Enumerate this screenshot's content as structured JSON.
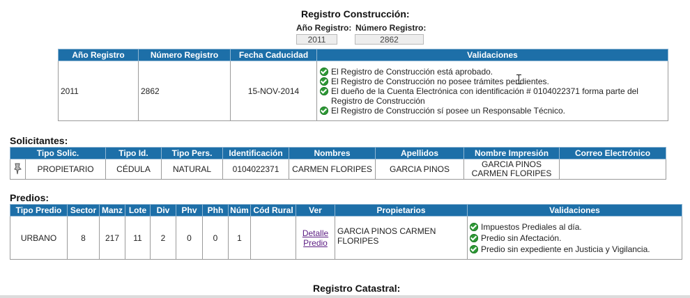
{
  "header": {
    "title": "Registro Construcción:",
    "anio_label": "Año Registro:",
    "numero_label": "Número Registro:",
    "anio_value": "2011",
    "numero_value": "2862"
  },
  "registro_table": {
    "columns": [
      "Año Registro",
      "Número Registro",
      "Fecha Caducidad",
      "Validaciones"
    ],
    "row": {
      "anio": "2011",
      "numero": "2862",
      "fecha": "15-NOV-2014",
      "validaciones": [
        "El Registro de Construcción está aprobado.",
        "El Registro de Construcción no posee trámites pendientes.",
        "El dueño de la Cuenta Electrónica con identificación # 0104022371 forma parte del Registro de Construcción",
        "El Registro de Construcción sí posee un Responsable Técnico."
      ]
    }
  },
  "solicitantes": {
    "section_title": "Solicitantes:",
    "columns": [
      "Tipo Solic.",
      "Tipo Id.",
      "Tipo Pers.",
      "Identificación",
      "Nombres",
      "Apellidos",
      "Nombre Impresión",
      "Correo Electrónico"
    ],
    "row": {
      "icon": "pin-icon",
      "tipo_solic": "PROPIETARIO",
      "tipo_id": "CÉDULA",
      "tipo_pers": "NATURAL",
      "identificacion": "0104022371",
      "nombres": "CARMEN FLORIPES",
      "apellidos": "GARCIA PINOS",
      "nombre_impresion_1": "GARCIA PINOS",
      "nombre_impresion_2": "CARMEN FLORIPES",
      "correo": ""
    }
  },
  "predios": {
    "section_title": "Predios:",
    "columns": [
      "Tipo Predio",
      "Sector",
      "Manz",
      "Lote",
      "Div",
      "Phv",
      "Phh",
      "Núm",
      "Cód Rural",
      "Ver",
      "Propietarios",
      "Validaciones"
    ],
    "row": {
      "tipo_predio": "URBANO",
      "sector": "8",
      "manz": "217",
      "lote": "11",
      "div": "2",
      "phv": "0",
      "phh": "0",
      "num": "1",
      "cod_rural": "",
      "ver_line1": "Detalle",
      "ver_line2": "Predio",
      "propietarios": "GARCIA PINOS CARMEN FLORIPES",
      "validaciones": [
        "Impuestos Prediales al día.",
        "Predio sin Afectación.",
        "Predio sin expediente en Justicia y Vigilancia."
      ]
    }
  },
  "catastral": {
    "title": "Registro Catastral:"
  },
  "colors": {
    "header_blue": "#1d6fa8",
    "check_green": "#2e9a36",
    "link_purple": "#5b1b82"
  }
}
